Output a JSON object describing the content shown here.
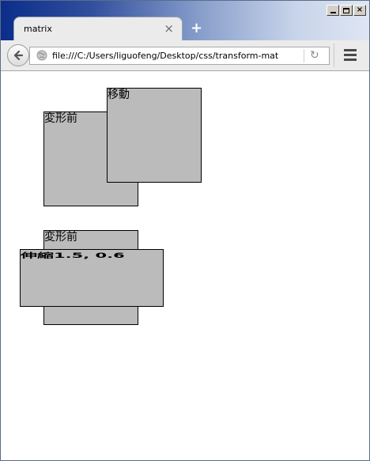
{
  "browser": {
    "tab_title": "matrix",
    "tab_close": "×",
    "new_tab": "+",
    "url": "file:///C:/Users/liguofeng/Desktop/css/transform-mat",
    "reload": "↻"
  },
  "window_controls": {
    "close": "×"
  },
  "page": {
    "translate_before_label": "変形前",
    "translate_after_label": "移動",
    "scale_before_label": "変形前",
    "scale_after_label": "伸縮1.5, 0.6"
  },
  "colors": {
    "box_fill": "#bbbbbb",
    "box_border": "#000000"
  }
}
